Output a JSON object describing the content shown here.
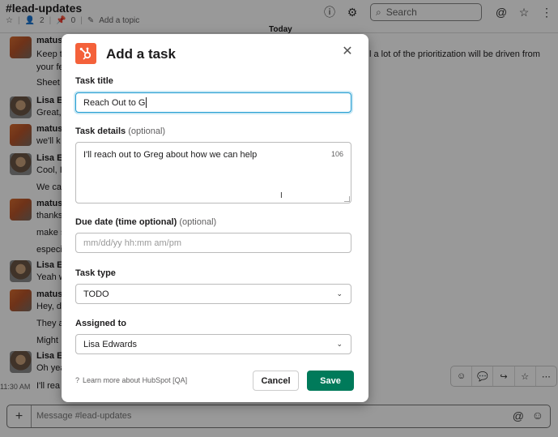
{
  "channel": {
    "title": "#lead-updates",
    "members_count": "2",
    "pins_count": "0",
    "add_topic": "Add a topic",
    "search_placeholder": "Search"
  },
  "timeline": {
    "day_divider": "Today",
    "messages": [
      {
        "author": "matus",
        "lines": [
          "Keep t",
          "your fe",
          "Sheet"
        ],
        "tail": "l a lot of the prioritization will be driven from"
      },
      {
        "author": "Lisa Ed",
        "lines": [
          "Great,"
        ]
      },
      {
        "author": "matus",
        "lines": [
          "we'll k"
        ]
      },
      {
        "author": "Lisa Ed",
        "lines": [
          "Cool, I",
          "We ca"
        ]
      },
      {
        "author": "matus",
        "lines": [
          "thanks",
          "make s",
          "especi"
        ]
      },
      {
        "author": "Lisa Ed",
        "lines": [
          "Yeah w"
        ]
      },
      {
        "author": "matus",
        "lines": [
          "Hey, d",
          "They a",
          "Might"
        ]
      },
      {
        "author": "Lisa Ed",
        "lines": [
          "Oh yea"
        ]
      },
      {
        "time": "11:30 AM",
        "lines": [
          "I'll rea"
        ]
      }
    ]
  },
  "composer": {
    "placeholder": "Message #lead-updates"
  },
  "modal": {
    "title": "Add a task",
    "task_title_label": "Task title",
    "task_title_value": "Reach Out to G",
    "task_details_label": "Task details",
    "optional": "(optional)",
    "task_details_value": "I'll reach out to Greg about how we can help",
    "task_details_remaining": "106",
    "due_date_label": "Due date (time optional)",
    "due_date_placeholder": "mm/dd/yy hh:mm am/pm",
    "task_type_label": "Task type",
    "task_type_value": "TODO",
    "assigned_label": "Assigned to",
    "assigned_value": "Lisa Edwards",
    "learn_more": "Learn more about HubSpot [QA]",
    "cancel": "Cancel",
    "save": "Save"
  },
  "colors": {
    "hubspot_orange": "#f4613a",
    "save_green": "#007a5a",
    "focus_blue": "#1d9bd1"
  }
}
